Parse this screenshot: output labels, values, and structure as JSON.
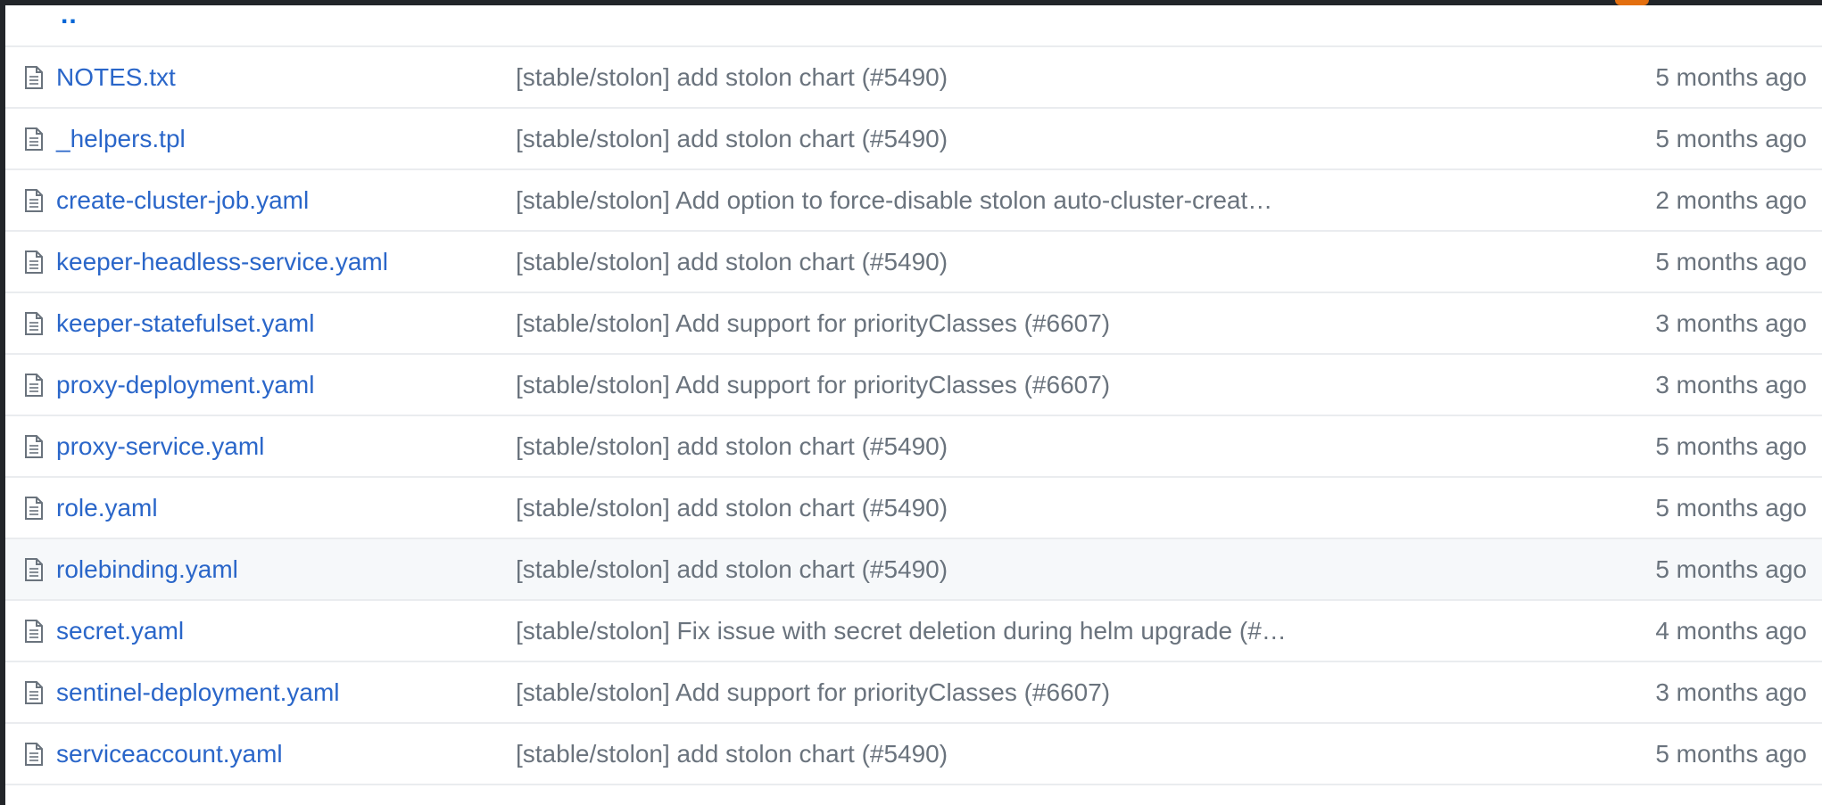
{
  "parent_link": "..",
  "colors": {
    "link": "#2a66c9",
    "muted": "#6a737d",
    "border": "#eaecef",
    "highlight_row": "#f6f8fa"
  },
  "files": [
    {
      "name": "NOTES.txt",
      "message": "[stable/stolon] add stolon chart (#5490)",
      "age": "5 months ago",
      "icon": "file-icon"
    },
    {
      "name": "_helpers.tpl",
      "message": "[stable/stolon] add stolon chart (#5490)",
      "age": "5 months ago",
      "icon": "file-icon"
    },
    {
      "name": "create-cluster-job.yaml",
      "message": "[stable/stolon] Add option to force-disable stolon auto-cluster-creat…",
      "age": "2 months ago",
      "icon": "file-icon"
    },
    {
      "name": "keeper-headless-service.yaml",
      "message": "[stable/stolon] add stolon chart (#5490)",
      "age": "5 months ago",
      "icon": "file-icon"
    },
    {
      "name": "keeper-statefulset.yaml",
      "message": "[stable/stolon] Add support for priorityClasses (#6607)",
      "age": "3 months ago",
      "icon": "file-icon"
    },
    {
      "name": "proxy-deployment.yaml",
      "message": "[stable/stolon] Add support for priorityClasses (#6607)",
      "age": "3 months ago",
      "icon": "file-icon"
    },
    {
      "name": "proxy-service.yaml",
      "message": "[stable/stolon] add stolon chart (#5490)",
      "age": "5 months ago",
      "icon": "file-icon"
    },
    {
      "name": "role.yaml",
      "message": "[stable/stolon] add stolon chart (#5490)",
      "age": "5 months ago",
      "icon": "file-icon"
    },
    {
      "name": "rolebinding.yaml",
      "message": "[stable/stolon] add stolon chart (#5490)",
      "age": "5 months ago",
      "icon": "file-icon",
      "highlighted": true
    },
    {
      "name": "secret.yaml",
      "message": "[stable/stolon] Fix issue with secret deletion during helm upgrade (#…",
      "age": "4 months ago",
      "icon": "file-icon"
    },
    {
      "name": "sentinel-deployment.yaml",
      "message": "[stable/stolon] Add support for priorityClasses (#6607)",
      "age": "3 months ago",
      "icon": "file-icon"
    },
    {
      "name": "serviceaccount.yaml",
      "message": "[stable/stolon] add stolon chart (#5490)",
      "age": "5 months ago",
      "icon": "file-icon"
    }
  ]
}
